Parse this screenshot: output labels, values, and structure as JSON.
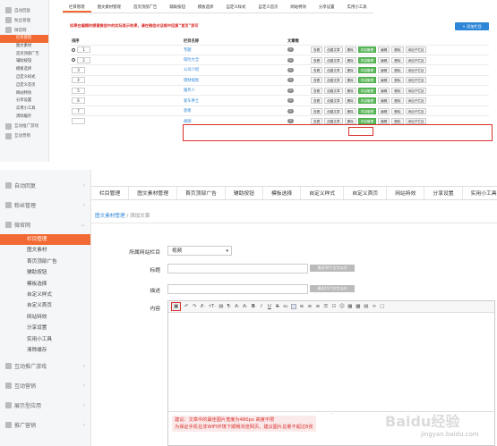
{
  "panel1": {
    "sidebar": {
      "groups_top": [
        "自动回复",
        "粉丝管理"
      ],
      "group_micro": "微官网",
      "subitems": [
        "栏目管理",
        "图文素材",
        "首页顶部广告",
        "辅助按钮",
        "模板选择",
        "自定义样式",
        "自定义首页",
        "网站特效",
        "分享设置",
        "实用小工具",
        "清除缓存"
      ],
      "groups_bottom": [
        "互动推广游戏",
        "互动营销"
      ]
    },
    "tabs": [
      "栏目管理",
      "图文素材管理",
      "首页顶部广告",
      "辅助按钮",
      "模板选择",
      "自定义样式",
      "自定义首页",
      "网站特效",
      "分享设置",
      "实用小工具"
    ],
    "warning": "如果在编辑时想看微信中的实际显示效果，请在微信对话框中回复“首页”即可",
    "add_button": "+ 添加栏目",
    "table": {
      "headers": [
        "排序",
        "",
        "栏目名称",
        "文章数",
        ""
      ],
      "rows": [
        {
          "sort": "1",
          "radio": true,
          "name": "专题",
          "count": "0"
        },
        {
          "sort": "2",
          "radio": true,
          "name": "保险大全",
          "count": "0"
        },
        {
          "sort": "3",
          "radio": false,
          "name": "公司介绍",
          "count": "0"
        },
        {
          "sort": "4",
          "radio": false,
          "name": "理财规划",
          "count": "0"
        },
        {
          "sort": "5",
          "radio": false,
          "name": "服务人",
          "count": "0"
        },
        {
          "sort": "6",
          "radio": false,
          "name": "爱车养士",
          "count": "0"
        },
        {
          "sort": "7",
          "radio": false,
          "name": "装修",
          "count": "0"
        },
        {
          "sort": "",
          "radio": false,
          "name": "视频",
          "count": "0"
        }
      ],
      "ops": [
        "查看",
        "创建文章",
        "删除",
        "内容管理",
        "编辑",
        "删除",
        "添加子栏目"
      ]
    }
  },
  "panel2": {
    "sidebar": {
      "groups_top": [
        "自动回复",
        "粉丝管理"
      ],
      "group_micro": "微官网",
      "subitems": [
        "栏目管理",
        "图文素材",
        "首页顶部广告",
        "辅助按钮",
        "模板选择",
        "自定义样式",
        "自定义首页",
        "网站特效",
        "分享设置",
        "实用小工具",
        "清除缓存"
      ],
      "groups_bottom": [
        "互动推广游戏",
        "互动营销",
        "展示型应用",
        "推广营销"
      ]
    },
    "tabs": [
      "栏目管理",
      "图文素材管理",
      "首页顶部广告",
      "辅助按钮",
      "模板选择",
      "自定义样式",
      "自定义首页",
      "网站特效",
      "分享设置",
      "实用小工具"
    ],
    "breadcrumb": {
      "first": "图文素材管理",
      "sep": "/",
      "current": "添加文章"
    },
    "form": {
      "column_label": "所属网站栏目",
      "column_value": "视频",
      "title_label": "标题",
      "title_hint": "建议50个文字以内",
      "desc_label": "描述",
      "desc_hint": "建议15个文字以内",
      "content_label": "内容"
    },
    "editor_tip_line1": "建议：文章中的最佳图片宽度为480px 高度不限",
    "editor_tip_line2": "为保证手机在非WIFI环境下顺畅浏览网页，建议图片总量不超过8张"
  },
  "watermark": "Baidu经验",
  "watermark_url": "jingyan.baidu.com"
}
